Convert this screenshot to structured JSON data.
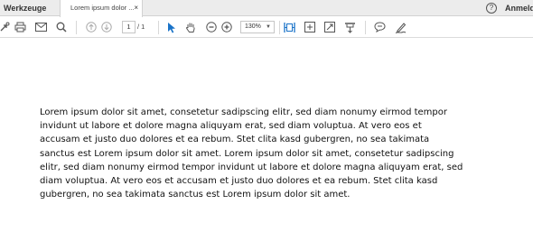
{
  "tabs": {
    "tools_label": "Werkzeuge",
    "document_label": "Lorem ipsum dolor ...",
    "close_glyph": "×"
  },
  "header": {
    "help_glyph": "?",
    "signin_label": "Anmelden"
  },
  "toolbar": {
    "icons": [
      "share-icon",
      "print-icon",
      "email-icon",
      "search-icon",
      "page-up-icon",
      "page-down-icon",
      "select-cursor-icon",
      "hand-tool-icon",
      "zoom-out-icon",
      "zoom-in-icon",
      "fit-width-icon",
      "fit-page-icon",
      "fullscreen-icon",
      "scroll-mode-icon",
      "comment-icon",
      "sign-icon"
    ],
    "page_current": "1",
    "page_total": "/ 1",
    "zoom_value": "130%",
    "accent_color": "#1a73c8"
  },
  "document": {
    "paragraph": "Lorem ipsum dolor sit amet, consetetur sadipscing elitr, sed diam nonumy eirmod tempor invidunt ut labore et dolore magna aliquyam erat, sed diam voluptua. At vero eos et accusam et justo duo dolores et ea rebum. Stet clita kasd gubergren, no sea takimata sanctus est Lorem ipsum dolor sit amet. Lorem ipsum dolor sit amet, consetetur sadipscing elitr, sed diam nonumy eirmod tempor invidunt ut labore et dolore magna aliquyam erat, sed diam voluptua. At vero eos et accusam et justo duo dolores et ea rebum. Stet clita kasd gubergren, no sea takimata sanctus est Lorem ipsum dolor sit amet."
  }
}
